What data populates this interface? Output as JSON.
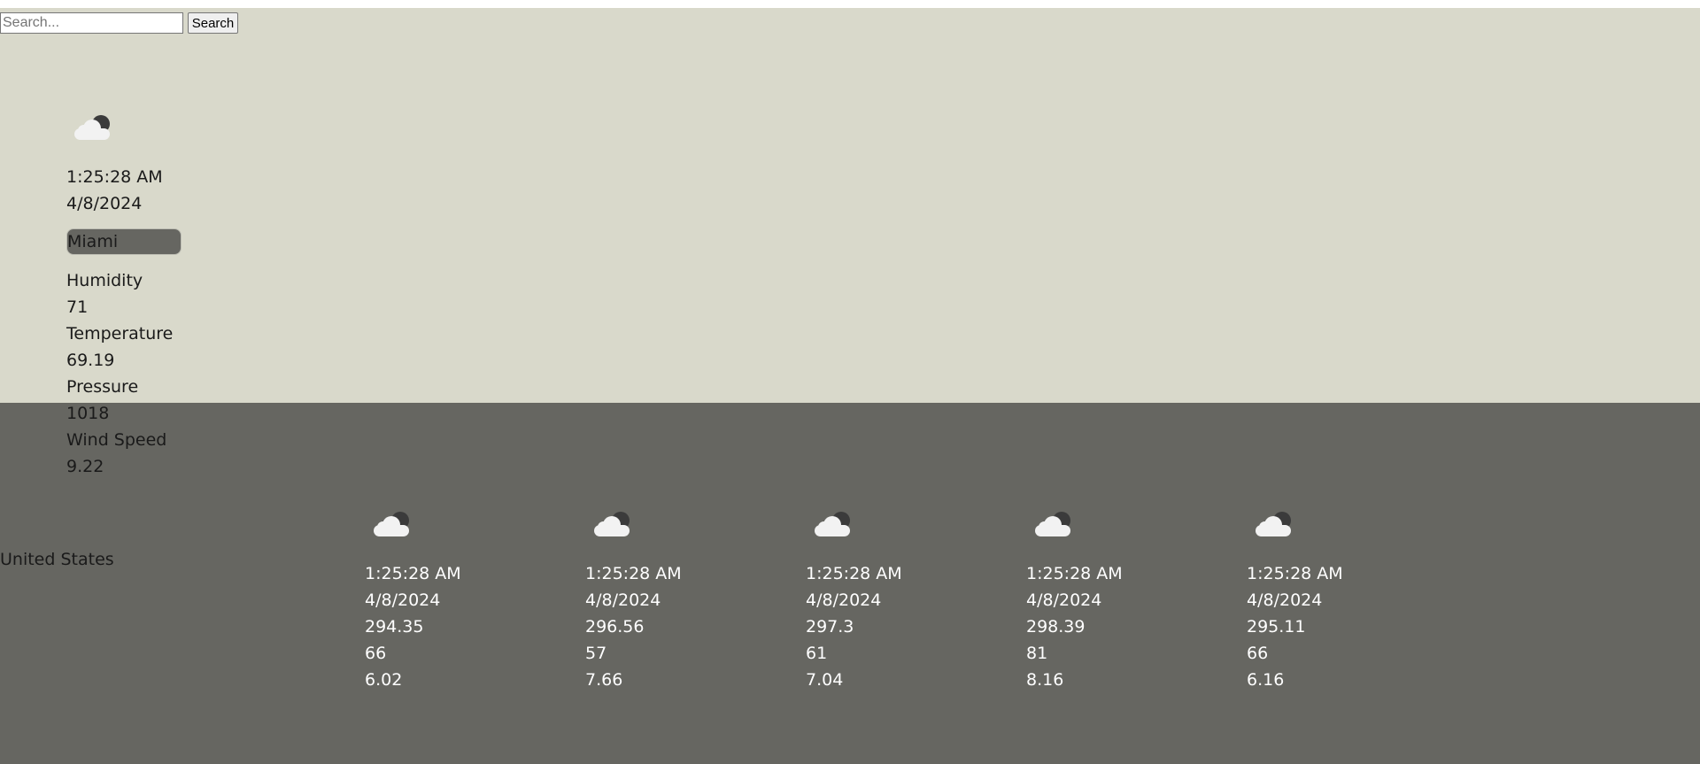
{
  "search": {
    "placeholder": "Search...",
    "button_label": "Search"
  },
  "current": {
    "icon": "cloud-moon-icon",
    "time": "1:25:28 AM",
    "date": "4/8/2024",
    "city": "Miami",
    "humidity_label": "Humidity",
    "humidity_value": "71",
    "temperature_label": "Temperature",
    "temperature_value": "69.19",
    "pressure_label": "Pressure",
    "pressure_value": "1018",
    "wind_label": "Wind Speed",
    "wind_value": "9.22",
    "country": "United States"
  },
  "forecast": [
    {
      "icon": "cloud-moon-icon",
      "time": "1:25:28 AM",
      "date": "4/8/2024",
      "temp": "294.35",
      "humidity": "66",
      "wind": "6.02"
    },
    {
      "icon": "cloud-moon-icon",
      "time": "1:25:28 AM",
      "date": "4/8/2024",
      "temp": "296.56",
      "humidity": "57",
      "wind": "7.66"
    },
    {
      "icon": "cloud-moon-icon",
      "time": "1:25:28 AM",
      "date": "4/8/2024",
      "temp": "297.3",
      "humidity": "61",
      "wind": "7.04"
    },
    {
      "icon": "cloud-moon-icon",
      "time": "1:25:28 AM",
      "date": "4/8/2024",
      "temp": "298.39",
      "humidity": "81",
      "wind": "8.16"
    },
    {
      "icon": "cloud-moon-icon",
      "time": "1:25:28 AM",
      "date": "4/8/2024",
      "temp": "295.11",
      "humidity": "66",
      "wind": "6.16"
    }
  ],
  "colors": {
    "upper_background": "#d9d9cb",
    "lower_background": "#666661",
    "forecast_text": "#ffffff",
    "body_text": "#1a1a1a"
  }
}
